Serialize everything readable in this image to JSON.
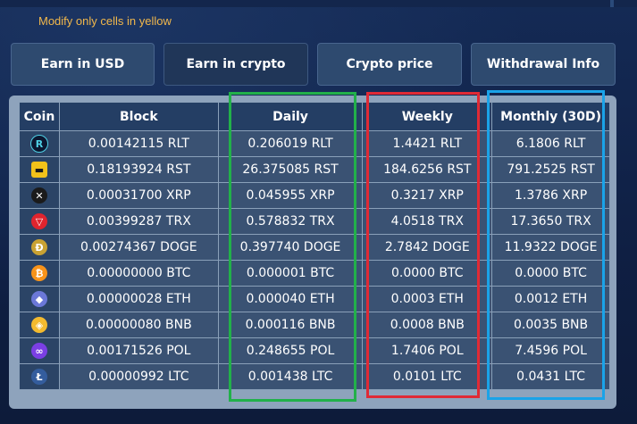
{
  "note": "Modify only cells in yellow",
  "tabs": [
    {
      "label": "Earn in USD"
    },
    {
      "label": "Earn in crypto"
    },
    {
      "label": "Crypto price"
    },
    {
      "label": "Withdrawal Info"
    }
  ],
  "active_tab": "Earn in crypto",
  "table": {
    "headers": [
      "Coin",
      "Block",
      "Daily",
      "Weekly",
      "Monthly (30D)"
    ],
    "rows": [
      {
        "coin_icon": "rlt-icon",
        "block": "0.00142115 RLT",
        "daily": "0.206019 RLT",
        "weekly": "1.4421 RLT",
        "monthly": "6.1806 RLT"
      },
      {
        "coin_icon": "rst-icon",
        "block": "0.18193924 RST",
        "daily": "26.375085 RST",
        "weekly": "184.6256 RST",
        "monthly": "791.2525 RST"
      },
      {
        "coin_icon": "xrp-icon",
        "block": "0.00031700 XRP",
        "daily": "0.045955 XRP",
        "weekly": "0.3217 XRP",
        "monthly": "1.3786 XRP"
      },
      {
        "coin_icon": "trx-icon",
        "block": "0.00399287 TRX",
        "daily": "0.578832 TRX",
        "weekly": "4.0518 TRX",
        "monthly": "17.3650 TRX"
      },
      {
        "coin_icon": "doge-icon",
        "block": "0.00274367 DOGE",
        "daily": "0.397740 DOGE",
        "weekly": "2.7842 DOGE",
        "monthly": "11.9322 DOGE"
      },
      {
        "coin_icon": "btc-icon",
        "block": "0.00000000 BTC",
        "daily": "0.000001 BTC",
        "weekly": "0.0000 BTC",
        "monthly": "0.0000 BTC"
      },
      {
        "coin_icon": "eth-icon",
        "block": "0.00000028 ETH",
        "daily": "0.000040 ETH",
        "weekly": "0.0003 ETH",
        "monthly": "0.0012 ETH"
      },
      {
        "coin_icon": "bnb-icon",
        "block": "0.00000080 BNB",
        "daily": "0.000116 BNB",
        "weekly": "0.0008 BNB",
        "monthly": "0.0035 BNB"
      },
      {
        "coin_icon": "pol-icon",
        "block": "0.00171526 POL",
        "daily": "0.248655 POL",
        "weekly": "1.7406 POL",
        "monthly": "7.4596 POL"
      },
      {
        "coin_icon": "ltc-icon",
        "block": "0.00000992 LTC",
        "daily": "0.001438 LTC",
        "weekly": "0.0101 LTC",
        "monthly": "0.0431 LTC"
      }
    ]
  },
  "colors": {
    "note": "#f2b84b",
    "daily_highlight": "#22b04a",
    "weekly_highlight": "#e02a35",
    "monthly_highlight": "#1aa3e8"
  }
}
